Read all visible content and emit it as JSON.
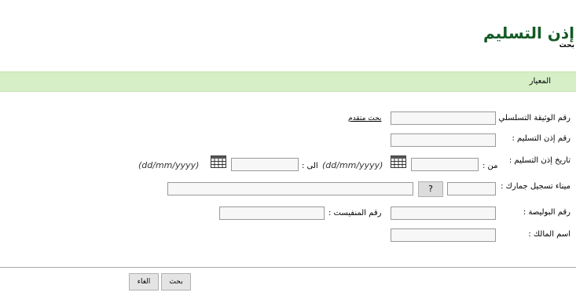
{
  "page": {
    "title": "إذن التسليم",
    "subtitle": "بحث"
  },
  "criteria": {
    "label": "المعيار"
  },
  "form": {
    "serial_label": "رقم الوثيقة التسلسلي :",
    "advanced_search": "بحث متقدم",
    "delivery_no_label": "رقم إذن التسليم :",
    "delivery_date_label": "تاريخ إذن التسليم :",
    "from_label": "من :",
    "to_label": "الى :",
    "date_hint_from": "(dd/mm/yyyy)",
    "date_hint_to": "(dd/mm/yyyy)",
    "customs_port_label": "ميناء تسجيل جمارك :",
    "lookup_button": "?",
    "policy_no_label": "رقم البوليصة :",
    "manifest_no_label": "رقم المنفيست :",
    "owner_name_label": "اسم المالك :"
  },
  "buttons": {
    "search": "بحث",
    "cancel": "الغاء"
  },
  "icons": {
    "calendar_from": "calendar-icon",
    "calendar_to": "calendar-icon"
  }
}
